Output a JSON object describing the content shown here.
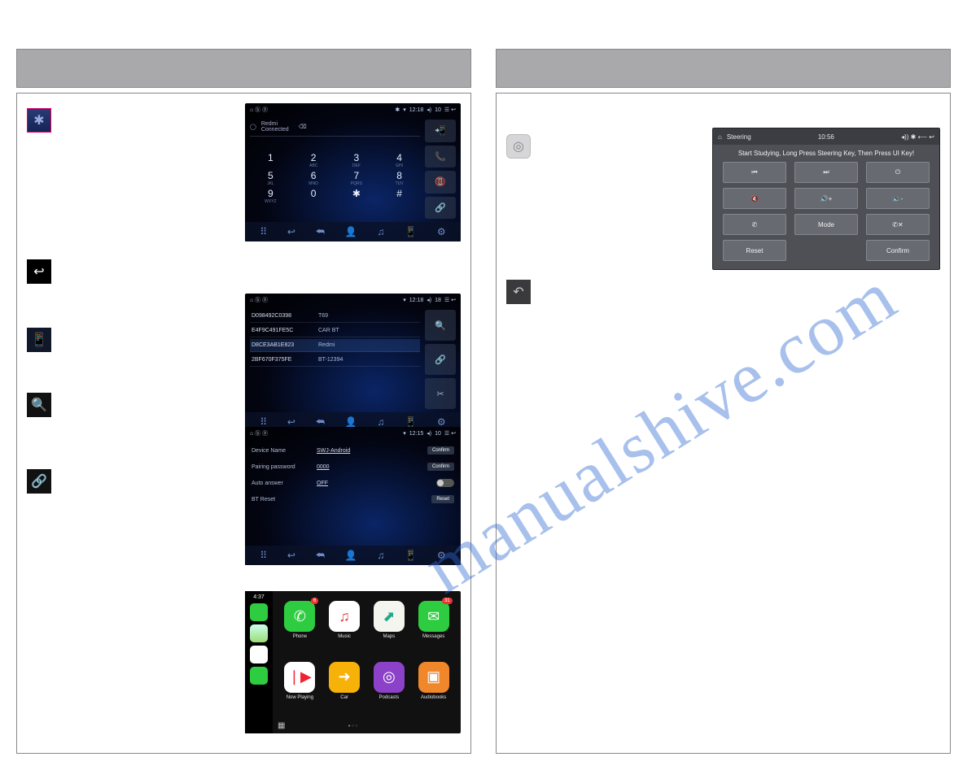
{
  "watermark": "manualshive.com",
  "left": {
    "screens": {
      "dialer": {
        "status": {
          "icons_left": "⌂ ⓑ ⓟ",
          "bt": "✱",
          "wifi": "▾",
          "time": "12:18",
          "vol": "◂)",
          "batt": "10",
          "more": "☰ ↩"
        },
        "device": {
          "name": "Redmi",
          "state": "Connected"
        },
        "backspace": "⌫",
        "keys": [
          [
            "1",
            ""
          ],
          [
            "2",
            "ABC"
          ],
          [
            "3",
            "DEF"
          ],
          [
            "4",
            "GHI"
          ],
          [
            "5",
            "JKL"
          ],
          [
            "6",
            "MNO"
          ],
          [
            "7",
            "PQRS"
          ],
          [
            "8",
            "TUV"
          ],
          [
            "9",
            "WXYZ"
          ],
          [
            "0",
            ""
          ],
          [
            "✱",
            ""
          ],
          [
            "#",
            ""
          ]
        ],
        "side": [
          "📲",
          "📞",
          "📵",
          "🔗"
        ],
        "foot": [
          "⠿",
          "↩",
          "⮪",
          "👤",
          "♫",
          "📱",
          "⚙"
        ]
      },
      "pair": {
        "status": {
          "icons_left": "⌂ ⓑ ⓟ",
          "wifi": "▾",
          "time": "12:18",
          "vol": "◂)",
          "batt": "18",
          "more": "☰ ↩"
        },
        "rows": [
          {
            "mac": "D098492C0398",
            "name": "T69"
          },
          {
            "mac": "E4F9C491FE5C",
            "name": "CAR BT"
          },
          {
            "mac": "D8CE3AB1E823",
            "name": "Redmi",
            "sel": true
          },
          {
            "mac": "2BF670F375FE",
            "name": "BT-12394"
          }
        ],
        "side": [
          "🔍",
          "🔗",
          "✂"
        ],
        "foot": [
          "⠿",
          "↩",
          "⮪",
          "👤",
          "♫",
          "📱",
          "⚙"
        ]
      },
      "settings": {
        "status": {
          "icons_left": "⌂ ⓑ ⓟ",
          "wifi": "▾",
          "time": "12:15",
          "vol": "◂)",
          "batt": "10",
          "more": "☰ ↩"
        },
        "rows": [
          {
            "label": "Device Name",
            "value": "SWJ-Android",
            "btn": "Confirm"
          },
          {
            "label": "Pairing password",
            "value": "0000",
            "btn": "Confirm"
          },
          {
            "label": "Auto answer",
            "value": "OFF",
            "toggle": true
          },
          {
            "label": "BT Reset",
            "value": "",
            "btn": "Reset"
          }
        ],
        "foot": [
          "⠿",
          "↩",
          "⮪",
          "👤",
          "♫",
          "📱",
          "⚙"
        ]
      },
      "carplay": {
        "time": "4:37",
        "apps": [
          {
            "name": "Phone",
            "color": "#2ecc40",
            "glyph": "✆",
            "badge": "6"
          },
          {
            "name": "Music",
            "color": "#ffffff",
            "glyph": "♫",
            "fg": "#e4403e"
          },
          {
            "name": "Maps",
            "color": "#f5f5f0",
            "glyph": "⬈",
            "fg": "#2a8"
          },
          {
            "name": "Messages",
            "color": "#2ecc40",
            "glyph": "✉",
            "badge": "31"
          },
          {
            "name": "Now Playing",
            "color": "#ffffff",
            "glyph": "❘▶",
            "fg": "#e23"
          },
          {
            "name": "Car",
            "color": "#f7b20a",
            "glyph": "➜",
            "fg": "#fff"
          },
          {
            "name": "Podcasts",
            "color": "#8b42c9",
            "glyph": "◎"
          },
          {
            "name": "Audiobooks",
            "color": "#f0872a",
            "glyph": "▣"
          }
        ]
      }
    }
  },
  "right": {
    "steer": {
      "title": "Steering",
      "time": "10:56",
      "status_icons": "◂)) ✱ ⟵ ↩",
      "msg": "Start Studying, Long Press Steering Key, Then Press UI Key!",
      "buttons": [
        "⏮",
        "⏭",
        "⏻",
        "🔇",
        "🔊+",
        "🔉-",
        "✆",
        "Mode",
        "✆✕",
        "Reset",
        "",
        "Confirm"
      ]
    }
  }
}
